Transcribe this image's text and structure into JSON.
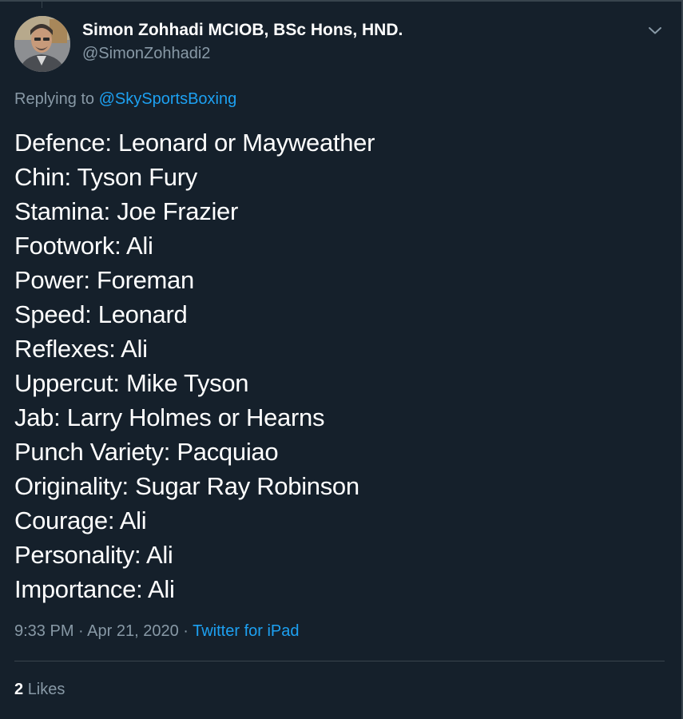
{
  "author": {
    "display_name": "Simon Zohhadi MCIOB, BSc Hons, HND.",
    "handle": "@SimonZohhadi2"
  },
  "reply": {
    "prefix": "Replying to ",
    "mention": "@SkySportsBoxing"
  },
  "tweet_lines": [
    "Defence: Leonard or Mayweather",
    "Chin: Tyson Fury",
    "Stamina: Joe Frazier",
    "Footwork: Ali",
    "Power: Foreman",
    "Speed: Leonard",
    "Reflexes: Ali",
    "Uppercut: Mike Tyson",
    "Jab: Larry Holmes or Hearns",
    "Punch Variety: Pacquiao",
    "Originality: Sugar Ray Robinson",
    "Courage: Ali",
    "Personality: Ali",
    "Importance: Ali"
  ],
  "meta": {
    "time": "9:33 PM",
    "separator": " · ",
    "date": "Apr 21, 2020",
    "source": "Twitter for iPad"
  },
  "engagement": {
    "likes_count": "2",
    "likes_label": "Likes"
  },
  "icons": {
    "caret": "chevron-down-icon",
    "avatar": "avatar"
  },
  "colors": {
    "background": "#15202b",
    "text": "#ffffff",
    "secondary": "#8899a6",
    "accent": "#1da1f2",
    "border": "#38444d"
  }
}
